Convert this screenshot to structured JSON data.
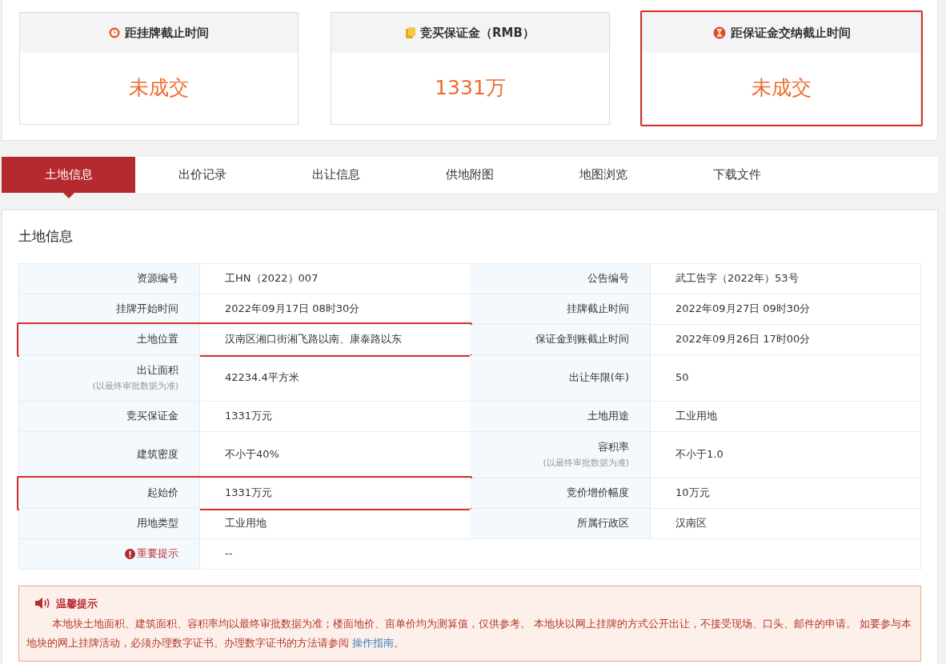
{
  "cards": [
    {
      "kind": "clock",
      "title": "距挂牌截止时间",
      "value": "未成交",
      "highlighted": false
    },
    {
      "kind": "coins",
      "title": "竞买保证金（RMB）",
      "value": "1331万",
      "highlighted": false
    },
    {
      "kind": "hourglass",
      "title": "距保证金交纳截止时间",
      "value": "未成交",
      "highlighted": true
    }
  ],
  "tabs": [
    {
      "label": "土地信息",
      "selected": true
    },
    {
      "label": "出价记录",
      "selected": false
    },
    {
      "label": "出让信息",
      "selected": false
    },
    {
      "label": "供地附图",
      "selected": false
    },
    {
      "label": "地图浏览",
      "selected": false
    },
    {
      "label": "下载文件",
      "selected": false
    }
  ],
  "section_title": "土地信息",
  "rows": [
    {
      "left": {
        "label": "资源编号",
        "value": "工HN（2022）007",
        "highlighted": false
      },
      "right": {
        "label": "公告编号",
        "value": "武工告字（2022年）53号"
      }
    },
    {
      "left": {
        "label": "挂牌开始时间",
        "value": "2022年09月17日 08时30分",
        "highlighted": false
      },
      "right": {
        "label": "挂牌截止时间",
        "value": "2022年09月27日 09时30分"
      }
    },
    {
      "left": {
        "label": "土地位置",
        "value": "汉南区湘口街湘飞路以南、康泰路以东",
        "highlighted": true
      },
      "right": {
        "label": "保证金到账截止时间",
        "value": "2022年09月26日 17时00分"
      }
    },
    {
      "left": {
        "label": "出让面积",
        "note": "(以最终审批数据为准)",
        "value": "42234.4平方米",
        "highlighted": false
      },
      "right": {
        "label": "出让年限(年)",
        "value": "50"
      }
    },
    {
      "left": {
        "label": "竞买保证金",
        "value": "1331万元",
        "highlighted": false
      },
      "right": {
        "label": "土地用途",
        "value": "工业用地"
      }
    },
    {
      "left": {
        "label": "建筑密度",
        "value": "不小于40%",
        "highlighted": false
      },
      "right": {
        "label": "容积率",
        "note": "(以最终审批数据为准)",
        "value": "不小于1.0"
      }
    },
    {
      "left": {
        "label": "起始价",
        "value": "1331万元",
        "highlighted": true
      },
      "right": {
        "label": "竞价增价幅度",
        "value": "10万元"
      }
    },
    {
      "left": {
        "label": "用地类型",
        "value": "工业用地",
        "highlighted": false
      },
      "right": {
        "label": "所属行政区",
        "value": "汉南区"
      }
    },
    {
      "left": {
        "kind": "warning",
        "label": "重要提示",
        "value": "--",
        "highlighted": false
      }
    }
  ],
  "notice": {
    "title": "温馨提示",
    "text": "本地块土地面积、建筑面积、容积率均以最终审批数据为准；楼面地价、亩单价均为测算值，仅供参考。 本地块以网上挂牌的方式公开出让，不接受现场、口头、邮件的申请。 如要参与本地块的网上挂牌活动，必须办理数字证书。办理数字证书的方法请参阅",
    "link": "操作指南",
    "end": "。"
  }
}
